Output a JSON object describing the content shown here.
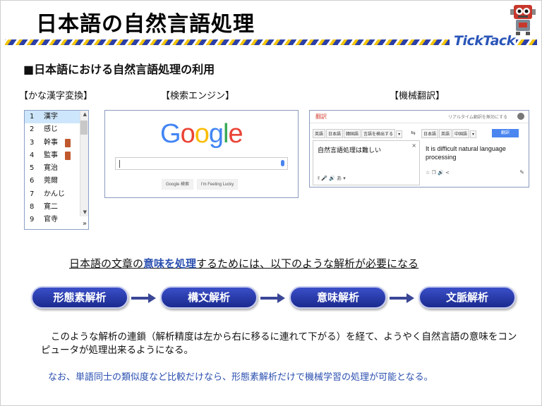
{
  "slide": {
    "title": "日本語の自然言語処理",
    "brand": "TickTack",
    "subtitle": "■日本語における自然言語処理の利用"
  },
  "sections": {
    "kana_label": "【かな漢字変換】",
    "search_label": "【検索エンジン】",
    "mt_label": "【機械翻訳】"
  },
  "ime": {
    "candidates": [
      {
        "num": "1",
        "text": "漢字"
      },
      {
        "num": "2",
        "text": "感じ"
      },
      {
        "num": "3",
        "text": "幹事"
      },
      {
        "num": "4",
        "text": "監事"
      },
      {
        "num": "5",
        "text": "寛治"
      },
      {
        "num": "6",
        "text": "莞爾"
      },
      {
        "num": "7",
        "text": "かんじ"
      },
      {
        "num": "8",
        "text": "寛二"
      },
      {
        "num": "9",
        "text": "官寺"
      }
    ],
    "more": "»"
  },
  "google": {
    "logo": [
      "G",
      "o",
      "o",
      "g",
      "l",
      "e"
    ],
    "logo_colors": [
      "#4285f4",
      "#ea4335",
      "#fbbc05",
      "#4285f4",
      "#34a853",
      "#ea4335"
    ],
    "search_button": "Google 検索",
    "lucky_button": "I'm Feeling Lucky"
  },
  "translate": {
    "header": "翻訳",
    "header_right": "リアルタイム翻訳を無効にする",
    "src_tabs": [
      "英語",
      "日本語",
      "韓国語",
      "言語を検出する",
      "▾"
    ],
    "dst_tabs": [
      "日本語",
      "英語",
      "中国語",
      "▾"
    ],
    "translate_button": "翻訳",
    "source_text": "自然言語処理は難しい",
    "target_text": "It is difficult natural language processing",
    "src_icons": "ऱ 🎤 🔊 あ ▾",
    "dst_icons": "☆ ❐ 🔊 <",
    "clear": "×",
    "swap": "⇆",
    "edit": "✎"
  },
  "sentence": {
    "pre": "日本語の文章の",
    "highlight": "意味を処理",
    "post": "するためには、以下のような解析が必要になる"
  },
  "steps": [
    "形態素解析",
    "構文解析",
    "意味解析",
    "文脈解析"
  ],
  "paragraph": "このような解析の連鎖（解析精度は左から右に移るに連れて下がる）を経て、ようやく自然言語の意味をコンピュータが処理出来るようになる。",
  "note": "なお、単語同士の類似度など比較だけなら、形態素解析だけで機械学習の処理が可能となる。"
}
